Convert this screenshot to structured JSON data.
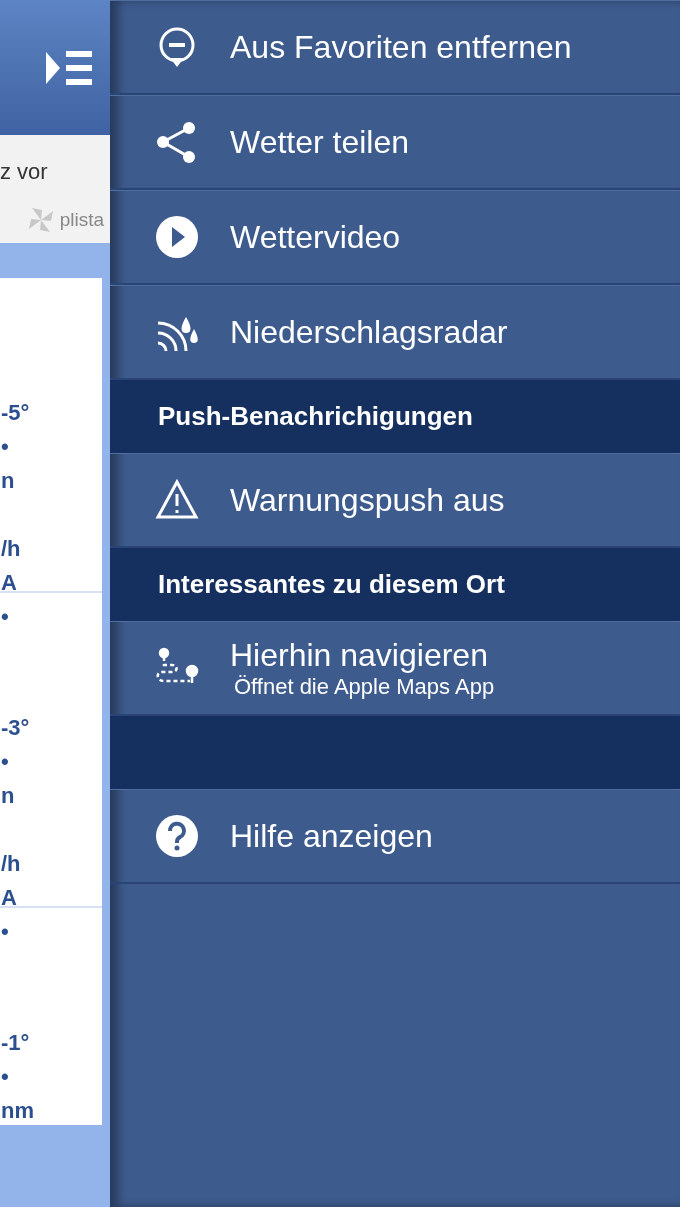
{
  "background_page": {
    "status_text": "z vor",
    "ad_label": "plista",
    "forecast": [
      {
        "lines": [
          "-5°",
          "•",
          "n",
          "/h",
          "A",
          "•"
        ]
      },
      {
        "lines": [
          "-3°",
          "•",
          "n",
          "/h",
          "A",
          "•"
        ]
      },
      {
        "lines": [
          "-1°",
          "•",
          "nm"
        ]
      }
    ]
  },
  "menu": [
    {
      "kind": "item",
      "label": "Aus Favoriten entfernen"
    },
    {
      "kind": "item",
      "label": "Wetter teilen"
    },
    {
      "kind": "item",
      "label": "Wettervideo"
    },
    {
      "kind": "item",
      "label": "Niederschlagsradar"
    },
    {
      "kind": "header",
      "label": "Push-Benachrichigungen"
    },
    {
      "kind": "item",
      "label": "Warnungspush aus"
    },
    {
      "kind": "header",
      "label": "Interessantes zu diesem Ort"
    },
    {
      "kind": "item",
      "label": "Hierhin navigieren",
      "subtitle": "Öffnet die Apple Maps App"
    },
    {
      "kind": "spacer"
    },
    {
      "kind": "item",
      "label": "Hilfe anzeigen"
    }
  ]
}
